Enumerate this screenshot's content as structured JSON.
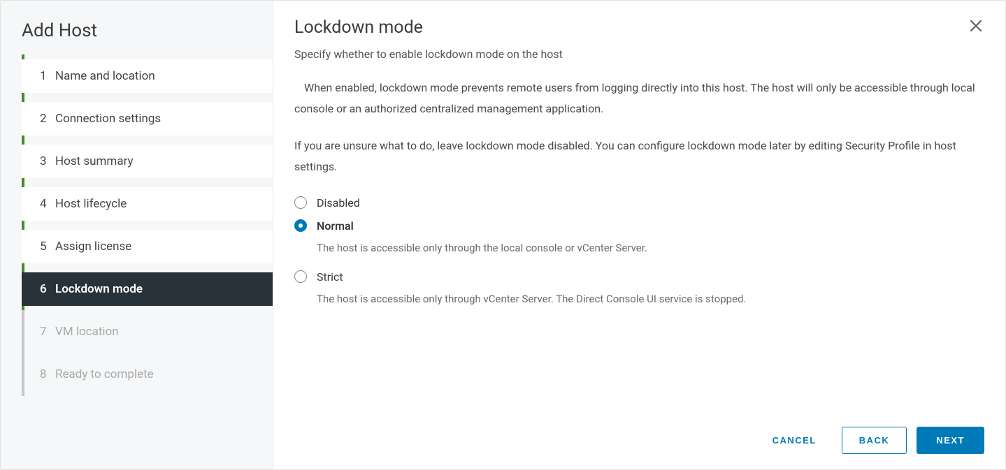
{
  "wizard": {
    "title": "Add Host",
    "steps": [
      {
        "num": "1",
        "label": "Name and location",
        "state": "completed"
      },
      {
        "num": "2",
        "label": "Connection settings",
        "state": "completed"
      },
      {
        "num": "3",
        "label": "Host summary",
        "state": "completed"
      },
      {
        "num": "4",
        "label": "Host lifecycle",
        "state": "completed"
      },
      {
        "num": "5",
        "label": "Assign license",
        "state": "completed"
      },
      {
        "num": "6",
        "label": "Lockdown mode",
        "state": "active"
      },
      {
        "num": "7",
        "label": "VM location",
        "state": "pending"
      },
      {
        "num": "8",
        "label": "Ready to complete",
        "state": "pending"
      }
    ]
  },
  "content": {
    "title": "Lockdown mode",
    "subtitle": "Specify whether to enable lockdown mode on the host",
    "paragraph1": "When enabled, lockdown mode prevents remote users from logging directly into this host. The host will only be accessible through local console or an authorized centralized management application.",
    "paragraph2": "If you are unsure what to do, leave lockdown mode disabled. You can configure lockdown mode later by editing Security Profile in host settings.",
    "options": [
      {
        "label": "Disabled",
        "desc": "",
        "checked": false
      },
      {
        "label": "Normal",
        "desc": "The host is accessible only through the local console or vCenter Server.",
        "checked": true
      },
      {
        "label": "Strict",
        "desc": "The host is accessible only through vCenter Server. The Direct Console UI service is stopped.",
        "checked": false
      }
    ]
  },
  "footer": {
    "cancel": "CANCEL",
    "back": "BACK",
    "next": "NEXT"
  }
}
